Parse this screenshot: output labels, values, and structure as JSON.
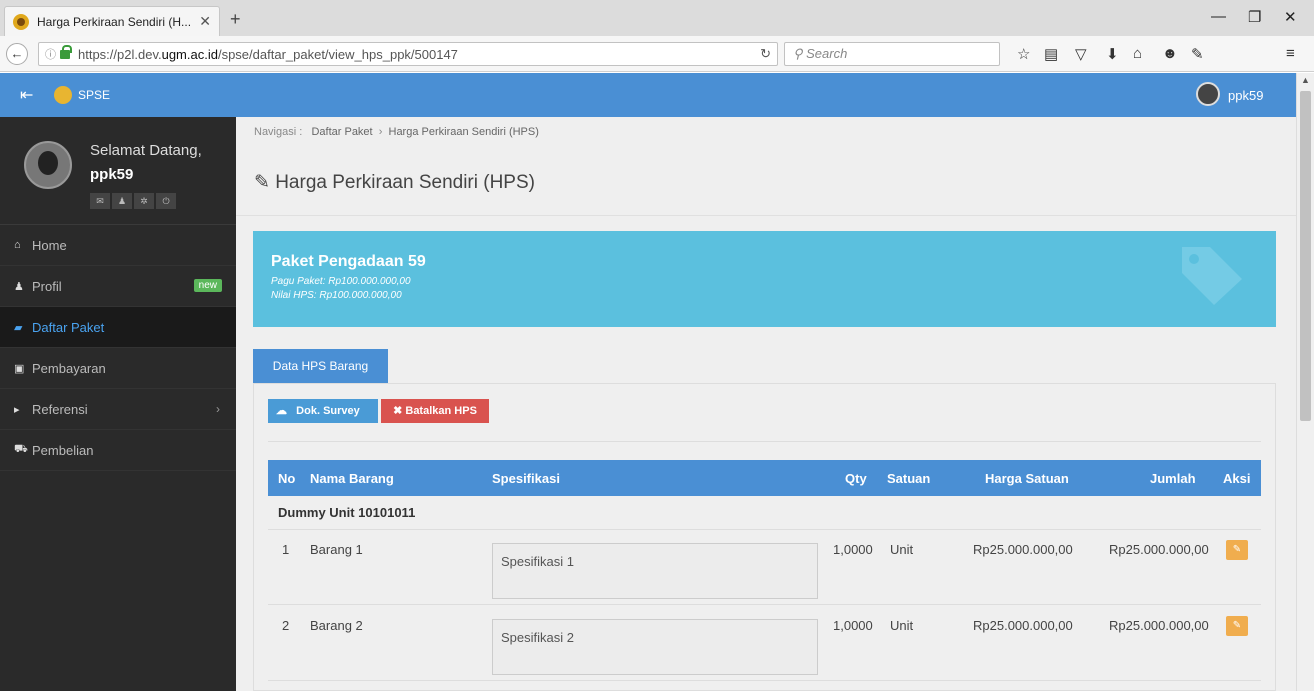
{
  "browser": {
    "tab_title": "Harga Perkiraan Sendiri (H...",
    "url_prefix": "https://p2l.dev.",
    "url_domain": "ugm.ac.id",
    "url_path": "/spse/daftar_paket/view_hps_ppk/500147",
    "search_placeholder": "Search"
  },
  "header": {
    "app_name": "SPSE",
    "user": "ppk59"
  },
  "sidebar": {
    "greeting": "Selamat Datang,",
    "username": "ppk59",
    "items": [
      {
        "label": "Home",
        "icon": "home-icon"
      },
      {
        "label": "Profil",
        "icon": "user-icon",
        "badge": "new"
      },
      {
        "label": "Daftar Paket",
        "icon": "book-icon",
        "active": true
      },
      {
        "label": "Pembayaran",
        "icon": "money-icon"
      },
      {
        "label": "Referensi",
        "icon": "caret-right-icon"
      },
      {
        "label": "Pembelian",
        "icon": "cart-icon"
      }
    ]
  },
  "main": {
    "breadcrumb_label": "Navigasi :",
    "breadcrumb": [
      "Daftar Paket",
      "Harga Perkiraan Sendiri (HPS)"
    ],
    "page_title": "Harga Perkiraan Sendiri (HPS)",
    "package": {
      "name": "Paket Pengadaan 59",
      "pagu": "Pagu Paket: Rp100.000.000,00",
      "nilai": "Nilai HPS: Rp100.000.000,00"
    },
    "tab_label": "Data HPS Barang",
    "btn_survey": "Dok. Survey",
    "btn_batal": "Batalkan HPS",
    "table": {
      "headers": [
        "No",
        "Nama Barang",
        "Spesifikasi",
        "Qty",
        "Satuan",
        "Harga Satuan",
        "Jumlah",
        "Aksi"
      ],
      "group": "Dummy Unit 10101011",
      "rows": [
        {
          "no": "1",
          "nama": "Barang 1",
          "spesifikasi": "Spesifikasi 1",
          "qty": "1,0000",
          "satuan": "Unit",
          "harga": "Rp25.000.000,00",
          "jumlah": "Rp25.000.000,00"
        },
        {
          "no": "2",
          "nama": "Barang 2",
          "spesifikasi": "Spesifikasi 2",
          "qty": "1,0000",
          "satuan": "Unit",
          "harga": "Rp25.000.000,00",
          "jumlah": "Rp25.000.000,00"
        }
      ]
    }
  }
}
